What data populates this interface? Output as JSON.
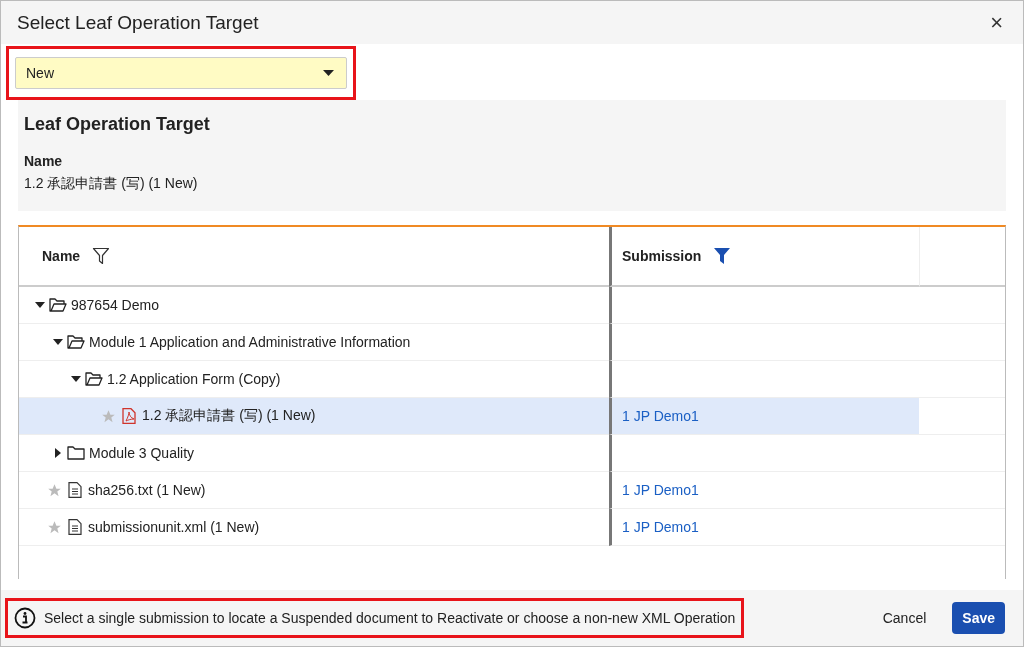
{
  "dialog": {
    "title": "Select Leaf Operation Target",
    "close": "×"
  },
  "operation_select": {
    "value": "New",
    "highlighted": true
  },
  "target": {
    "heading": "Leaf Operation Target",
    "name_label": "Name",
    "name_value": "1.2 承認申請書 (写) (1 New)"
  },
  "table": {
    "columns": [
      {
        "label": "Name",
        "filter_active": false
      },
      {
        "label": "Submission",
        "filter_active": true
      }
    ],
    "rows": [
      {
        "kind": "folder",
        "name": "987654 Demo",
        "expanded": true,
        "selected": false,
        "children": [
          {
            "kind": "folder",
            "name": "Module 1 Application and Administrative Information",
            "expanded": true,
            "selected": false,
            "children": [
              {
                "kind": "folder",
                "name": "1.2 Application Form (Copy)",
                "expanded": true,
                "selected": false,
                "children": [
                  {
                    "kind": "pdf",
                    "name": "1.2 承認申請書 (写) (1 New)",
                    "submission": "1 JP Demo1",
                    "selected": true
                  }
                ]
              }
            ]
          },
          {
            "kind": "folder",
            "name": "Module 3 Quality",
            "expanded": false,
            "selected": false
          }
        ]
      },
      {
        "kind": "file",
        "name": "sha256.txt (1 New)",
        "submission": "1 JP Demo1",
        "selected": false
      },
      {
        "kind": "file",
        "name": "submissionunit.xml (1 New)",
        "submission": "1 JP Demo1",
        "selected": false
      }
    ]
  },
  "footer": {
    "message": "Select a single submission to locate a Suspended document to Reactivate or choose a non-new XML Operation",
    "message_highlighted": true,
    "buttons": [
      {
        "label": "Cancel",
        "kind": "secondary"
      },
      {
        "label": "Save",
        "kind": "primary"
      }
    ]
  }
}
